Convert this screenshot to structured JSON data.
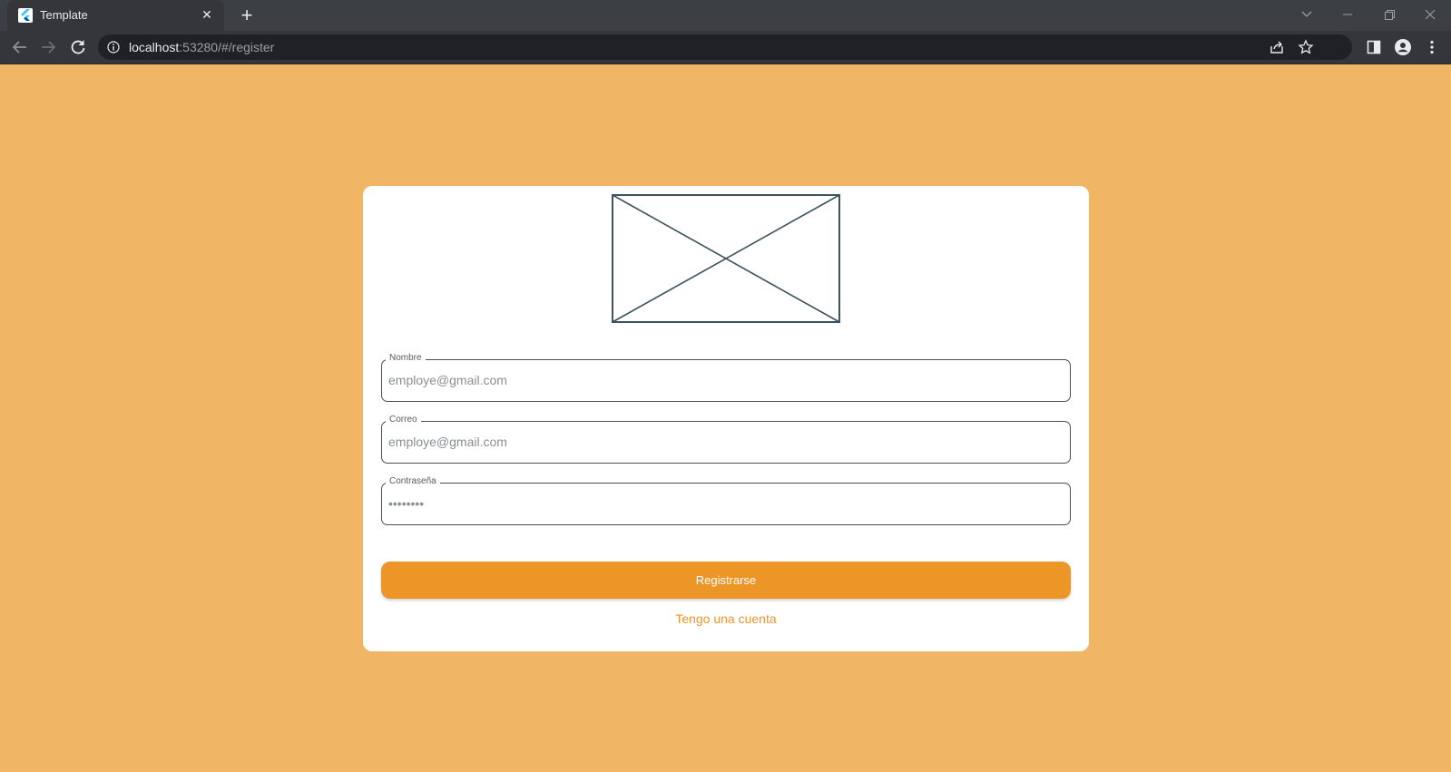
{
  "browser": {
    "tab_title": "Template",
    "new_tab_symbol": "+",
    "close_tab_symbol": "✕",
    "url_host": "localhost",
    "url_rest": ":53280/#/register"
  },
  "form": {
    "fields": [
      {
        "label": "Nombre",
        "placeholder": "employe@gmail.com",
        "type": "text"
      },
      {
        "label": "Correo",
        "placeholder": "employe@gmail.com",
        "type": "text"
      },
      {
        "label": "Contraseña",
        "placeholder": "••••••••",
        "type": "password"
      }
    ],
    "submit_label": "Registrarse",
    "account_link": "Tengo una cuenta"
  },
  "colors": {
    "page_bg": "#f1b566",
    "accent": "#ec9628",
    "card_bg": "#ffffff",
    "placeholder_image_stroke": "#3d5360"
  },
  "icons": {
    "logo": "image-placeholder-icon",
    "back": "arrow-left-icon",
    "forward": "arrow-right-icon",
    "reload": "reload-icon",
    "share": "share-icon",
    "bookmark": "star-icon",
    "sidepanel": "side-panel-icon",
    "profile": "profile-icon",
    "menu": "kebab-menu-icon"
  }
}
